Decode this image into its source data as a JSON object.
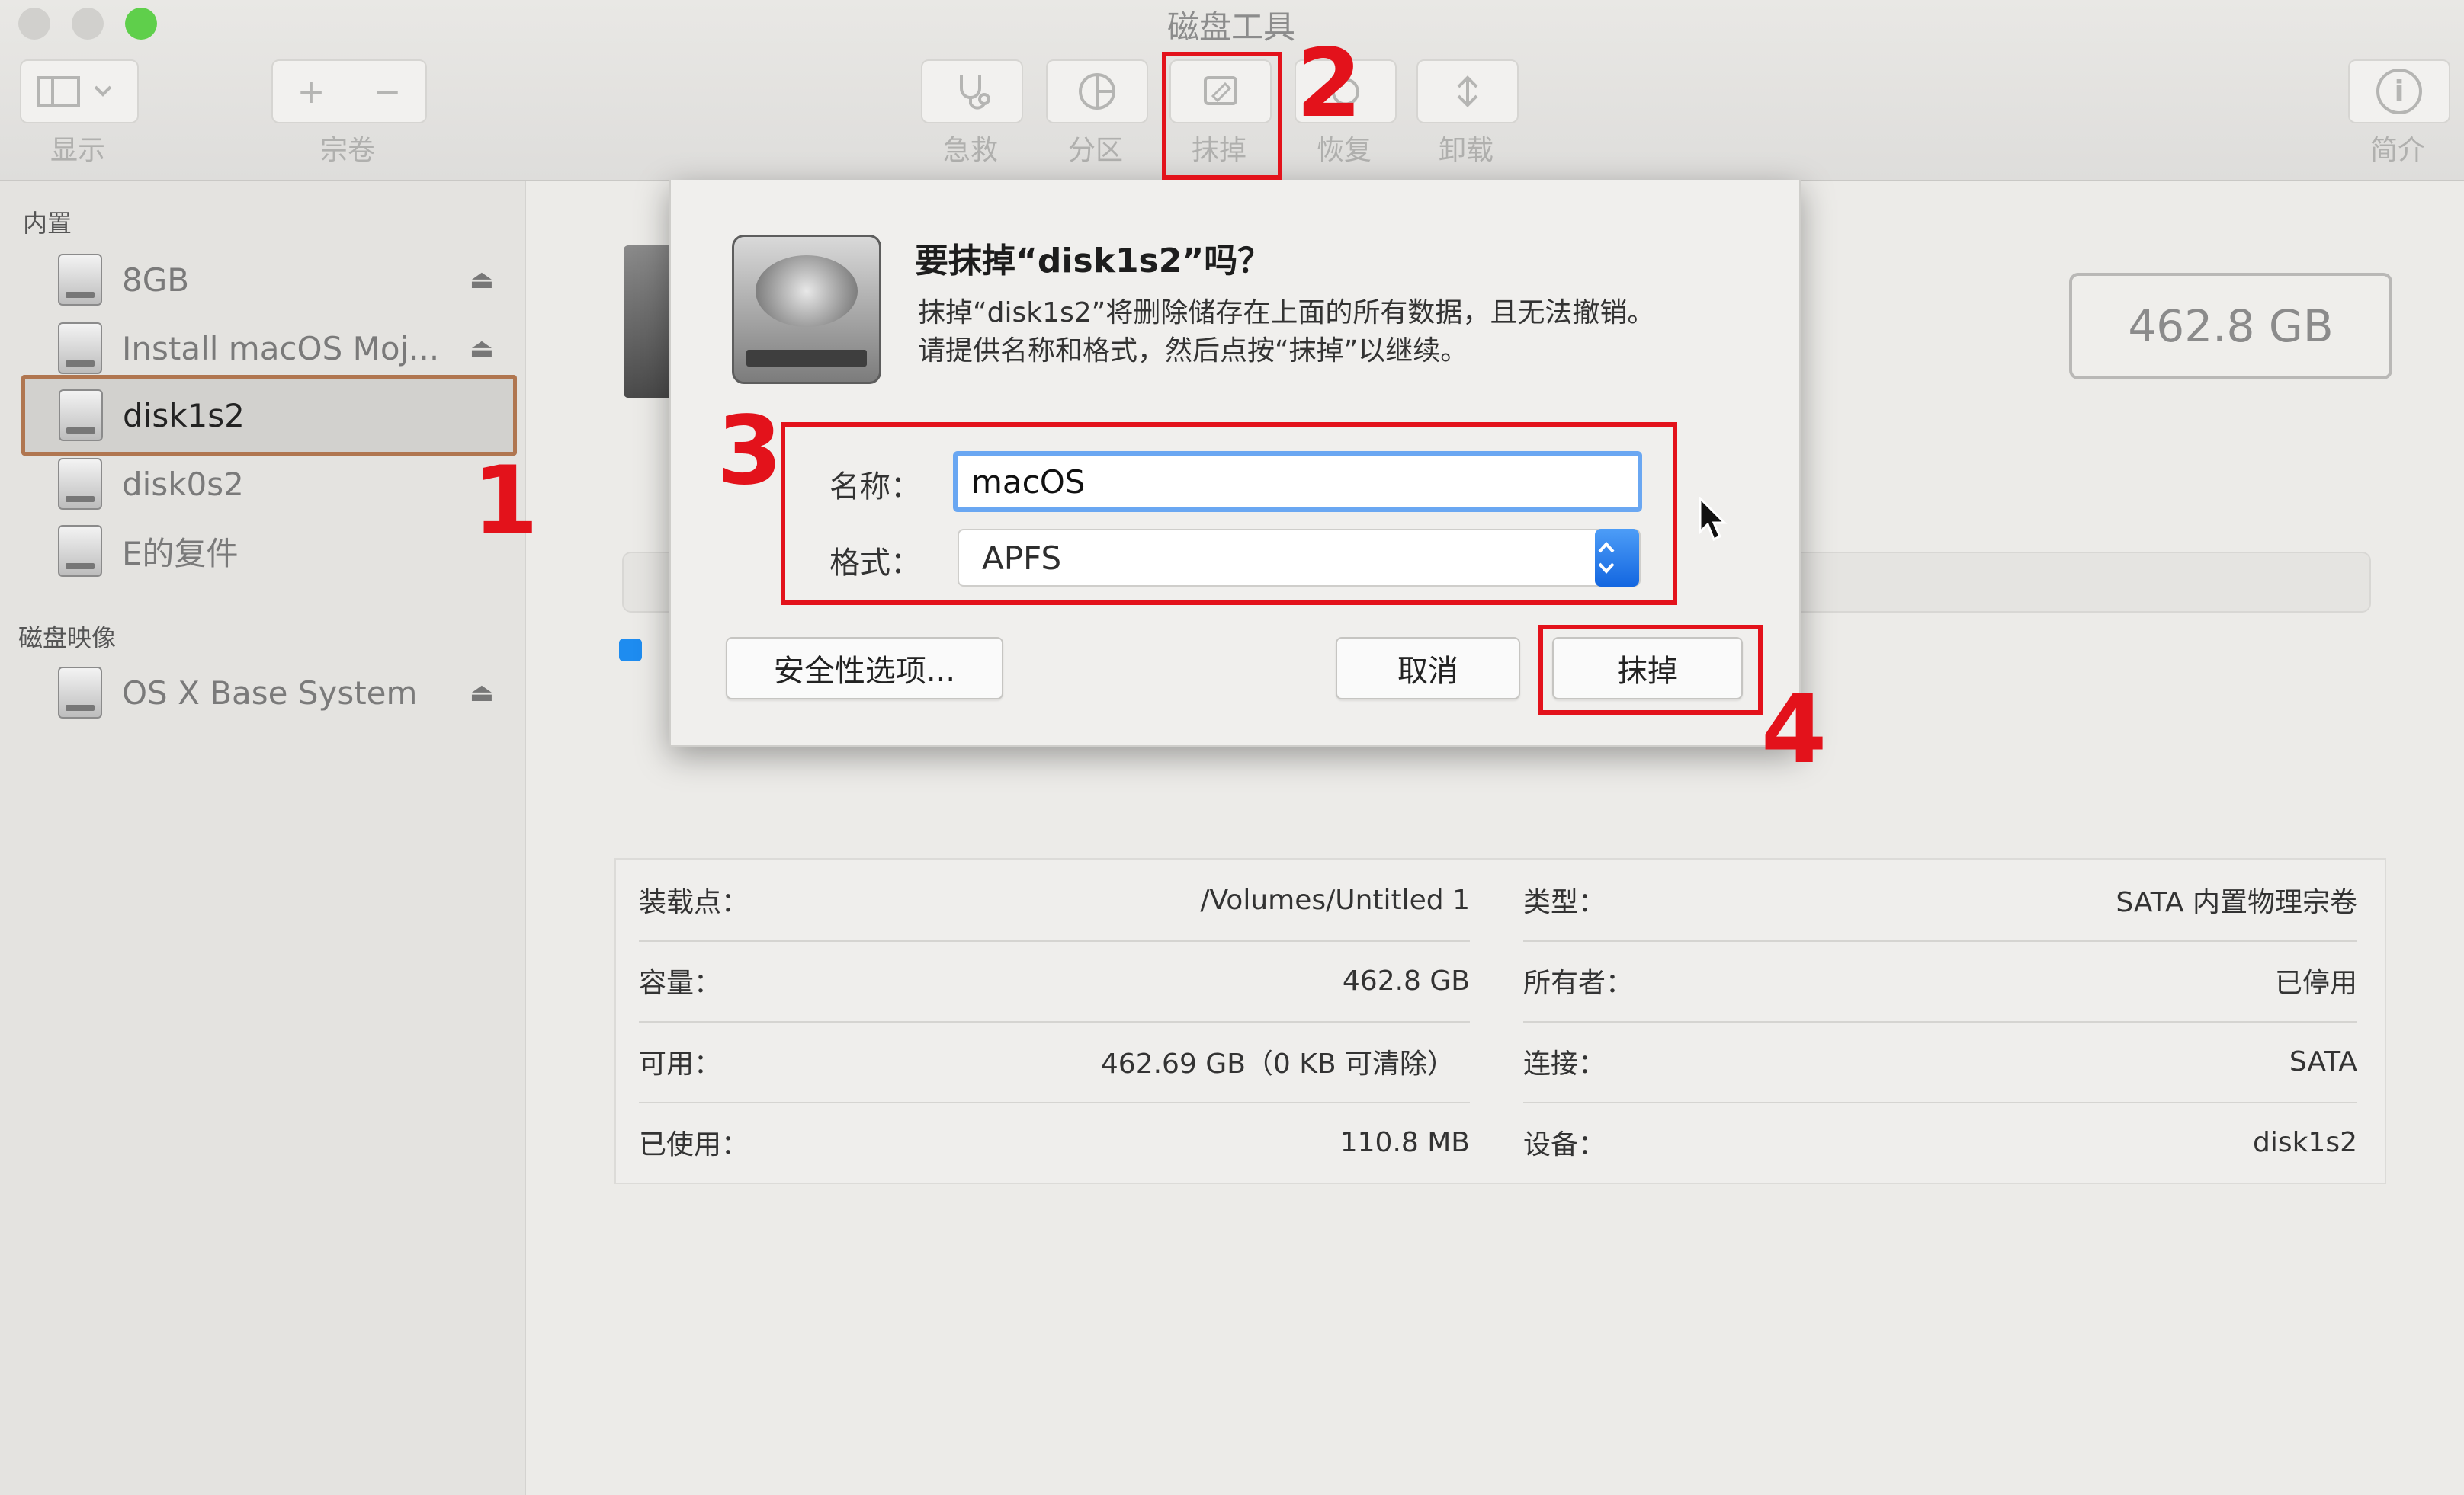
{
  "window": {
    "title": "磁盘工具"
  },
  "toolbar": {
    "view_label": "显示",
    "volume_label": "宗卷",
    "add_symbol": "+",
    "remove_symbol": "−",
    "first_aid_label": "急救",
    "partition_label": "分区",
    "erase_label": "抹掉",
    "restore_label": "恢复",
    "unmount_label": "卸载",
    "info_label": "简介",
    "info_symbol": "i"
  },
  "sidebar": {
    "internal_section": "内置",
    "items": [
      {
        "name": "8GB",
        "eject": "⏏"
      },
      {
        "name": "Install macOS Moj...",
        "eject": "⏏"
      },
      {
        "name": "disk1s2"
      },
      {
        "name": "disk0s2"
      },
      {
        "name": "E的复件"
      }
    ],
    "images_section": "磁盘映像",
    "image_items": [
      {
        "name": "OS X Base System",
        "eject": "⏏"
      }
    ]
  },
  "main": {
    "capacity_badge": "462.8 GB",
    "info": {
      "left": [
        {
          "label": "装载点：",
          "value": "/Volumes/Untitled 1"
        },
        {
          "label": "容量：",
          "value": "462.8 GB"
        },
        {
          "label": "可用：",
          "value": "462.69 GB（0 KB 可清除）"
        },
        {
          "label": "已使用：",
          "value": "110.8 MB"
        }
      ],
      "right": [
        {
          "label": "类型：",
          "value": "SATA 内置物理宗卷"
        },
        {
          "label": "所有者：",
          "value": "已停用"
        },
        {
          "label": "连接：",
          "value": "SATA"
        },
        {
          "label": "设备：",
          "value": "disk1s2"
        }
      ]
    }
  },
  "dialog": {
    "title": "要抹掉“disk1s2”吗？",
    "message_line1": "抹掉“disk1s2”将删除储存在上面的所有数据，且无法撤销。",
    "message_line2": "请提供名称和格式，然后点按“抹掉”以继续。",
    "name_label": "名称：",
    "name_value": "macOS",
    "format_label": "格式：",
    "format_value": "APFS",
    "security_button": "安全性选项...",
    "cancel_button": "取消",
    "erase_button": "抹掉"
  },
  "annotations": {
    "step1": "1",
    "step2": "2",
    "step3": "3",
    "step4": "4",
    "color": "#e3121b"
  }
}
